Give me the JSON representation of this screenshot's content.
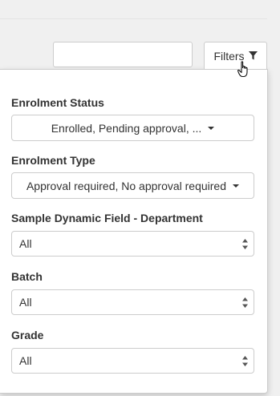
{
  "search": {
    "value": "",
    "placeholder": ""
  },
  "filters_button": {
    "label": "Filters",
    "icon": "filter-funnel-icon"
  },
  "filters_panel": {
    "enrolment_status": {
      "label": "Enrolment Status",
      "value": "Enrolled, Pending approval, ..."
    },
    "enrolment_type": {
      "label": "Enrolment Type",
      "value": "Approval required, No approval required"
    },
    "department": {
      "label": "Sample Dynamic Field - Department",
      "value": "All"
    },
    "batch": {
      "label": "Batch",
      "value": "All"
    },
    "grade": {
      "label": "Grade",
      "value": "All"
    }
  },
  "colors": {
    "border": "#cccccc",
    "text": "#333333",
    "page_background": "#f0f0f0",
    "panel_background": "#ffffff"
  }
}
